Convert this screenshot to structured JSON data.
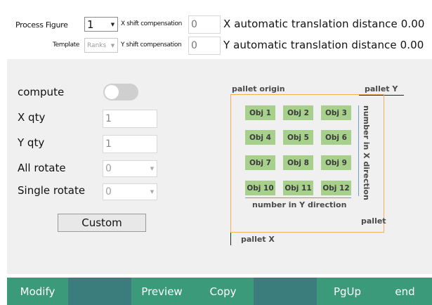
{
  "header": {
    "process_figure_label": "Process Figure",
    "process_figure_value": "1",
    "template_label": "Template",
    "template_value": "Ranks",
    "x_shift_label": "X shift compensation",
    "x_shift_value": "0",
    "y_shift_label": "Y shift compensation",
    "y_shift_value": "0",
    "x_auto_label": "X automatic translation distance 0.00",
    "y_auto_label": "Y automatic translation distance 0.00"
  },
  "form": {
    "compute_label": "compute",
    "compute_on": false,
    "x_qty_label": "X qty",
    "x_qty_value": "1",
    "y_qty_label": "Y qty",
    "y_qty_value": "1",
    "all_rotate_label": "All rotate",
    "all_rotate_value": "0",
    "single_rotate_label": "Single rotate",
    "single_rotate_value": "0",
    "custom_label": "Custom"
  },
  "diagram": {
    "pallet_origin": "pallet origin",
    "pallet_y": "pallet Y",
    "pallet_x": "pallet X",
    "pallet": "pallet",
    "number_x_direction": "number in X direction",
    "number_y_direction": "number in Y direction",
    "objects": [
      "Obj 1",
      "Obj 2",
      "Obj 3",
      "Obj 4",
      "Obj 5",
      "Obj 6",
      "Obj 7",
      "Obj 8",
      "Obj 9",
      "Obj 10",
      "Obj 11",
      "Obj 12"
    ]
  },
  "buttons": {
    "modify": "Modify",
    "preview": "Preview",
    "copy": "Copy",
    "pgup": "PgUp",
    "end": "end"
  },
  "colors": {
    "button_green": "#3b9a7a",
    "button_gap": "#3b7c7c",
    "object_fill": "#a8d08d",
    "pallet_border": "#f0b35c",
    "panel_bg": "#f0f0f0"
  }
}
